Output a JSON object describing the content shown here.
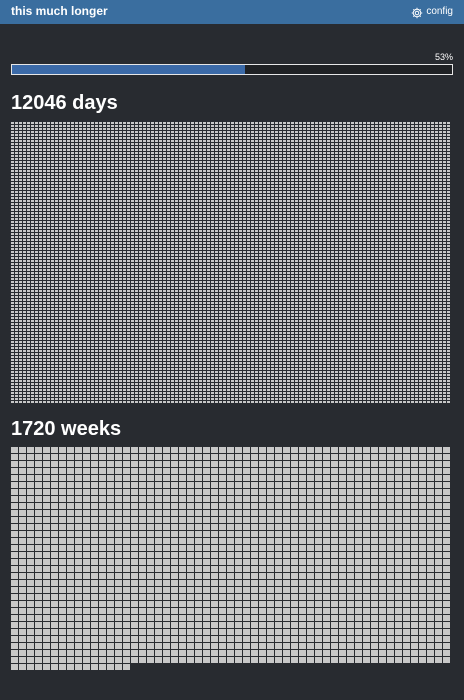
{
  "header": {
    "title": "this much longer",
    "config_label": "config",
    "config_icon": "gear-icon"
  },
  "progress": {
    "percent_label": "53%",
    "fraction": 0.53,
    "fill_color": "#3b6aa8"
  },
  "days": {
    "heading": "12046 days",
    "count": 12046,
    "cell_color": "#c8c8c8"
  },
  "weeks": {
    "heading": "1720 weeks",
    "count": 1720,
    "cell_color": "#c8c8c8"
  }
}
